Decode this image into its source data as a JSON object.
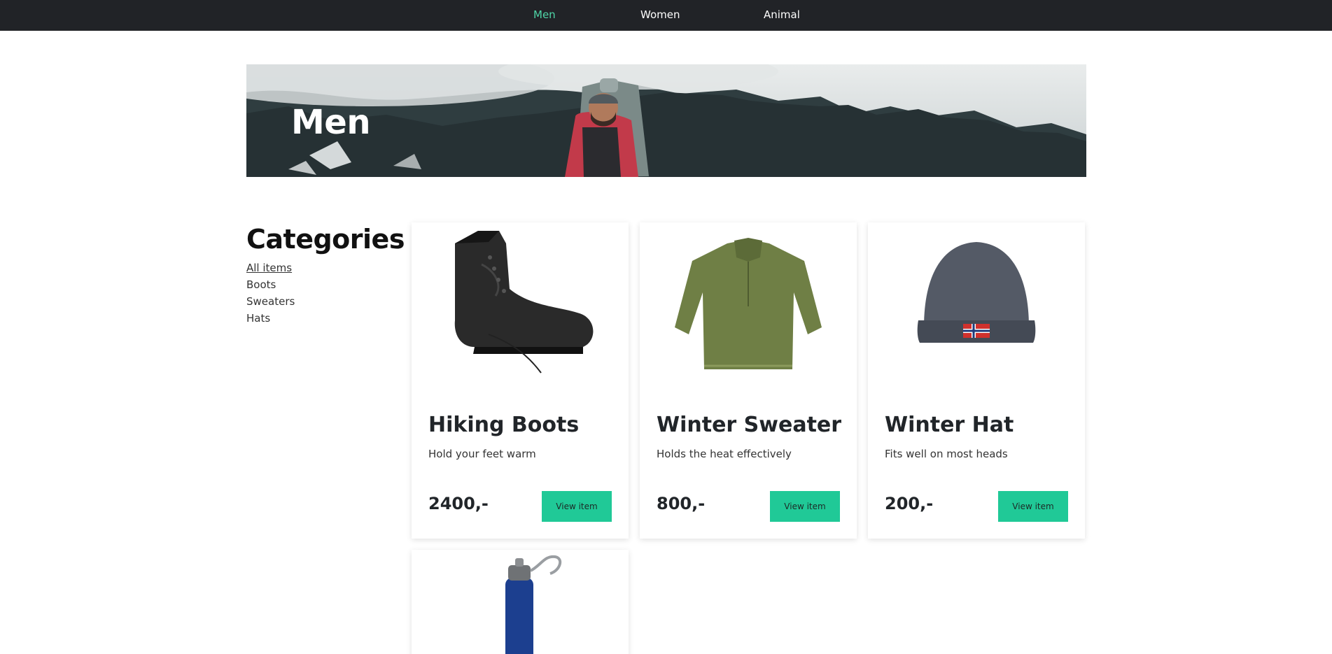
{
  "nav": {
    "items": [
      {
        "label": "Men",
        "active": true
      },
      {
        "label": "Women",
        "active": false
      },
      {
        "label": "Animal",
        "active": false
      }
    ]
  },
  "hero": {
    "title": "Men"
  },
  "sidebar": {
    "title": "Categories",
    "items": [
      {
        "label": "All items",
        "active": true
      },
      {
        "label": "Boots",
        "active": false
      },
      {
        "label": "Sweaters",
        "active": false
      },
      {
        "label": "Hats",
        "active": false
      }
    ]
  },
  "products": [
    {
      "name": "Hiking Boots",
      "description": "Hold your feet warm",
      "price": "2400,-",
      "button_label": "View item",
      "image_icon": "boot-image"
    },
    {
      "name": "Winter Sweater",
      "description": "Holds the heat effectively",
      "price": "800,-",
      "button_label": "View item",
      "image_icon": "sweater-image"
    },
    {
      "name": "Winter Hat",
      "description": "Fits well on most heads",
      "price": "200,-",
      "button_label": "View item",
      "image_icon": "hat-image"
    },
    {
      "image_icon": "water-bottle-image"
    }
  ],
  "colors": {
    "nav_bg": "#212327",
    "accent": "#20c997",
    "nav_active": "#4fd6a8"
  }
}
